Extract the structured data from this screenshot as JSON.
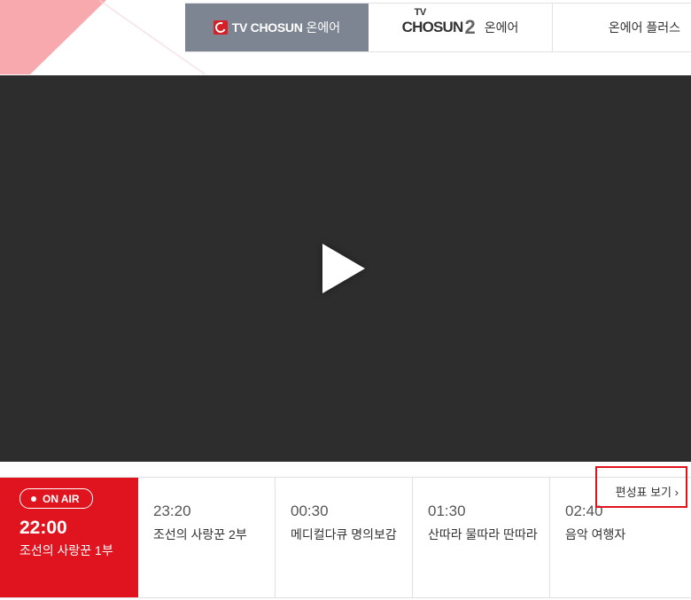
{
  "tabs": {
    "tab1": {
      "brand": "TV CHOSUN",
      "label": "온에어"
    },
    "tab2": {
      "brand_tv": "TV",
      "brand_name": "CHOSUN",
      "brand_num": "2",
      "label": "온에어"
    },
    "tab3": {
      "label": "온에어 플러스"
    }
  },
  "player": {
    "state": "paused"
  },
  "schedule": {
    "now": {
      "badge": "ON AIR",
      "time": "22:00",
      "title": "조선의 사랑꾼 1부"
    },
    "items": [
      {
        "time": "23:20",
        "title": "조선의 사랑꾼 2부"
      },
      {
        "time": "00:30",
        "title": "메디컬다큐 명의보감"
      },
      {
        "time": "01:30",
        "title": "산따라 물따라 딴따라"
      },
      {
        "time": "02:40",
        "title": "음악 여행자"
      }
    ],
    "link_label": "편성표 보기",
    "link_chevron": "›"
  },
  "colors": {
    "accent": "#e0141e",
    "active_tab": "#7d8592",
    "player_bg": "#2d2d2d"
  }
}
